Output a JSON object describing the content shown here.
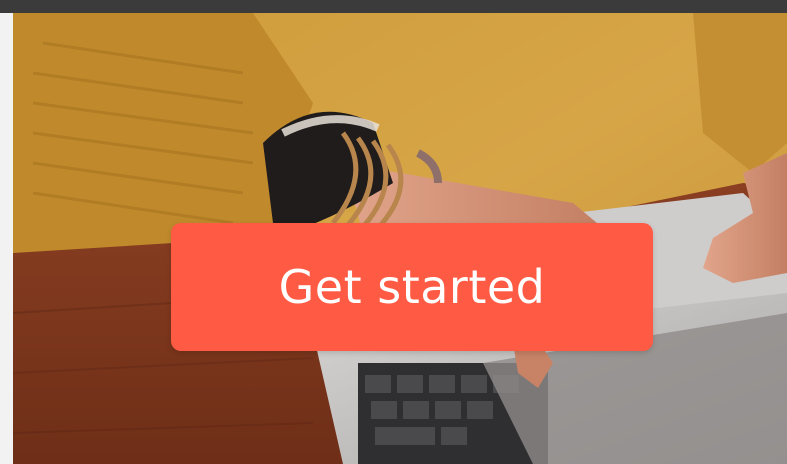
{
  "hero": {
    "cta_label": "Get started",
    "cta_color": "#ff5a43",
    "image_subject": "person-typing-on-laptop-photo"
  }
}
